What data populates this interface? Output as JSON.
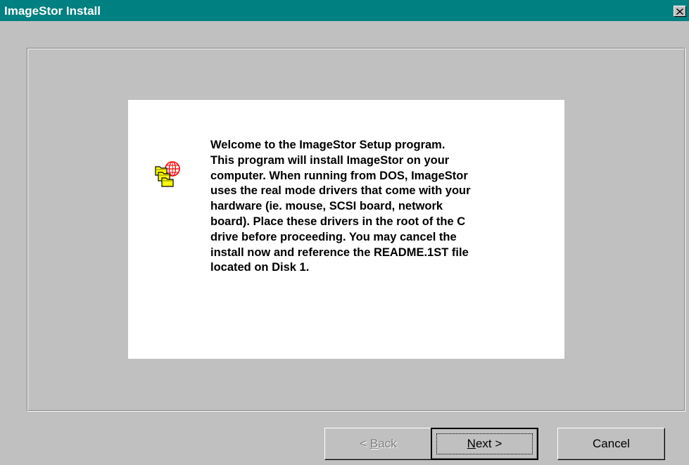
{
  "window": {
    "title": "ImageStor Install",
    "close_icon": "close-icon",
    "title_bar_color": "#008080"
  },
  "welcome": {
    "icon": "imagestor-setup-icon",
    "message": "Welcome to the ImageStor Setup program.\nThis program will install ImageStor on your\ncomputer.  When running from DOS, ImageStor\nuses the real mode drivers that come with your\nhardware (ie. mouse, SCSI board, network\nboard).  Place these drivers in the root of the C\ndrive before proceeding.  You may cancel the\ninstall now and reference the README.1ST file\nlocated on Disk 1."
  },
  "buttons": {
    "back": {
      "arrow": "<",
      "mnemonic": "B",
      "rest": "ack",
      "enabled": false
    },
    "next": {
      "mnemonic": "N",
      "rest": "ext",
      "arrow": ">",
      "enabled": true,
      "focused": true
    },
    "cancel": {
      "label": "Cancel",
      "enabled": true
    }
  }
}
